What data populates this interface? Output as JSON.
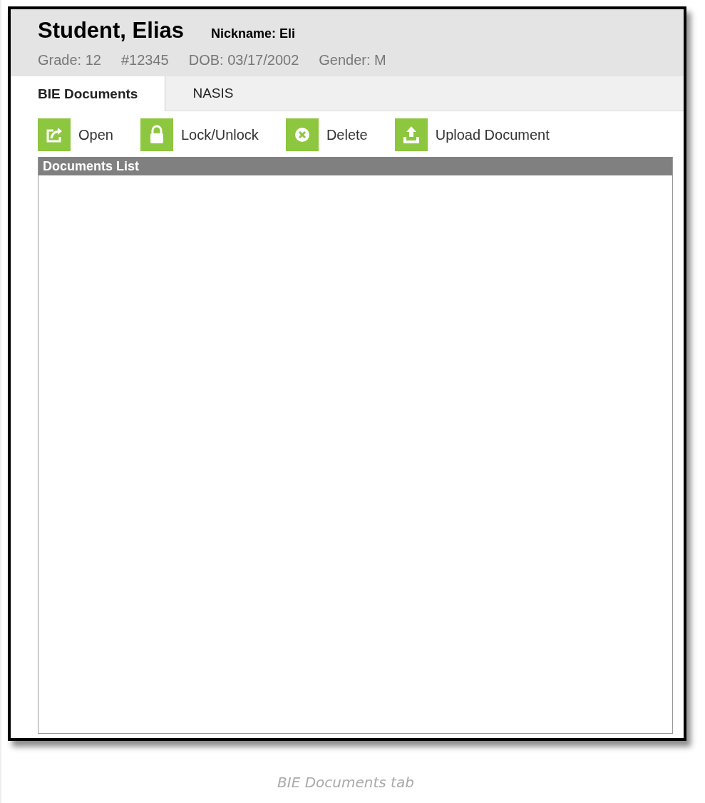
{
  "student": {
    "name": "Student, Elias",
    "nickname": "Nickname: Eli",
    "details": [
      "Grade: 12",
      "#12345",
      "DOB: 03/17/2002",
      "Gender: M"
    ]
  },
  "tabs": [
    {
      "label": "BIE Documents",
      "selected": true
    },
    {
      "label": "NASIS",
      "selected": false
    }
  ],
  "toolbar": [
    {
      "kind": "open",
      "label": "Open"
    },
    {
      "kind": "lock",
      "label": "Lock/Unlock"
    },
    {
      "kind": "delete",
      "label": "Delete"
    },
    {
      "kind": "upload",
      "label": "Upload Document"
    }
  ],
  "documents_list": {
    "title": "Documents List"
  },
  "caption": "BIE Documents tab"
}
